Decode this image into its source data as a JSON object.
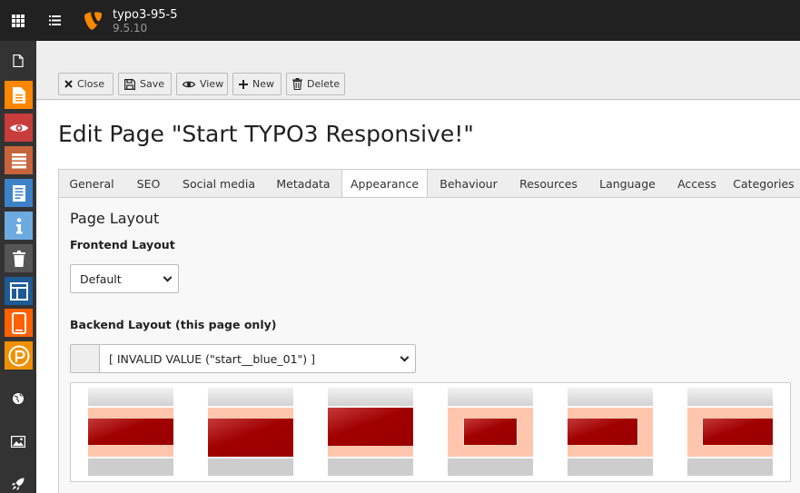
{
  "header": {
    "site_name": "typo3-95-5",
    "site_version": "9.5.10"
  },
  "sidebar": {
    "items": [
      {
        "name": "page",
        "color": "#ff8700"
      },
      {
        "name": "view",
        "color": "#c83c3c"
      },
      {
        "name": "list",
        "color": "#c8643c"
      },
      {
        "name": "form",
        "color": "#3c82c8"
      },
      {
        "name": "info",
        "color": "#6daae0"
      },
      {
        "name": "recycler",
        "color": "#555555"
      },
      {
        "name": "template",
        "color": "#1e5a96"
      },
      {
        "name": "mobile",
        "color": "#ff6000"
      },
      {
        "name": "powermail",
        "color": "#f09000"
      }
    ]
  },
  "toolbar": {
    "close_label": "Close",
    "save_label": "Save",
    "view_label": "View",
    "new_label": "New",
    "delete_label": "Delete"
  },
  "page_title": "Edit Page \"Start TYPO3 Responsive!\"",
  "tabs": [
    {
      "label": "General"
    },
    {
      "label": "SEO"
    },
    {
      "label": "Social media"
    },
    {
      "label": "Metadata"
    },
    {
      "label": "Appearance"
    },
    {
      "label": "Behaviour"
    },
    {
      "label": "Resources"
    },
    {
      "label": "Language"
    },
    {
      "label": "Access"
    },
    {
      "label": "Categories"
    }
  ],
  "active_tab": "Appearance",
  "form": {
    "section_title": "Page Layout",
    "frontend_layout_label": "Frontend Layout",
    "frontend_layout_value": "Default",
    "backend_layout_label": "Backend Layout (this page only)",
    "backend_layout_value": "[ INVALID VALUE (\"start__blue_01\") ]"
  },
  "colors": {
    "accent": "#ff8700",
    "layout_red": "#a00000",
    "layout_band": "#ffc6ad"
  }
}
